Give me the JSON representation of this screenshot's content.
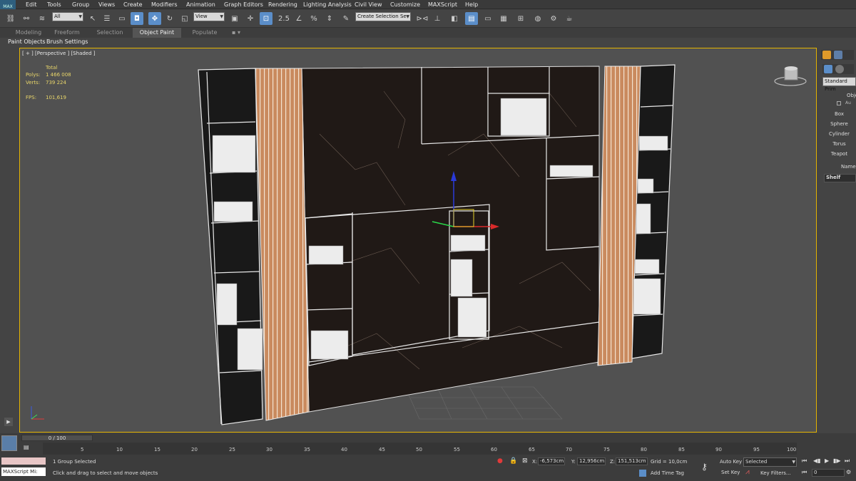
{
  "app": {
    "logo": "MAX"
  },
  "menubar": [
    "Edit",
    "Tools",
    "Group",
    "Views",
    "Create",
    "Modifiers",
    "Animation",
    "Graph Editors",
    "Rendering",
    "Lighting Analysis",
    "Civil View",
    "Customize",
    "MAXScript",
    "Help"
  ],
  "toolbar": {
    "filter_value": "All",
    "refcoord_value": "View",
    "selection_set_placeholder": "Create Selection Se"
  },
  "ribbon": {
    "tabs": [
      "Modeling",
      "Freeform",
      "Selection",
      "Object Paint",
      "Populate"
    ],
    "active_tab": "Object Paint",
    "subtabs": [
      "Paint Objects",
      "Brush Settings"
    ]
  },
  "viewport": {
    "label": "[ + ] [Perspective ] [Shaded ]",
    "stats": {
      "total_label": "Total",
      "polys_label": "Polys:",
      "polys_value": "1 466 008",
      "verts_label": "Verts:",
      "verts_value": "739 224",
      "fps_label": "FPS:",
      "fps_value": "101,619"
    }
  },
  "command_panel": {
    "category": "Standard Prim",
    "rollout_title": "Obje",
    "autogrid": "Au",
    "buttons": [
      "Box",
      "Sphere",
      "Cylinder",
      "Torus",
      "Teapot"
    ],
    "name_rollout": "Name",
    "name_value": "Shelf"
  },
  "timeline": {
    "frame_counter": "0 / 100",
    "ticks": [
      "5",
      "10",
      "15",
      "20",
      "25",
      "30",
      "35",
      "40",
      "45",
      "50",
      "55",
      "60",
      "65",
      "70",
      "75",
      "80",
      "85",
      "90",
      "95",
      "100"
    ]
  },
  "statusbar": {
    "maxscript_label": "MAXScript Mi:",
    "selection_status": "1 Group Selected",
    "prompt": "Click and drag to select and move objects",
    "x_label": "X:",
    "x_value": "-6,573cm",
    "y_label": "Y:",
    "y_value": "12,956cm",
    "z_label": "Z:",
    "z_value": "151,513cm",
    "grid": "Grid = 10,0cm",
    "add_time_tag": "Add Time Tag",
    "auto_key": "Auto Key",
    "set_key": "Set Key",
    "key_mode_value": "Selected",
    "key_filters": "Key Filters...",
    "current_frame": "0"
  },
  "colors": {
    "active_blue": "#5b8ec9",
    "viewport_border": "#e4b400",
    "stats_yellow": "#e8d56a"
  }
}
